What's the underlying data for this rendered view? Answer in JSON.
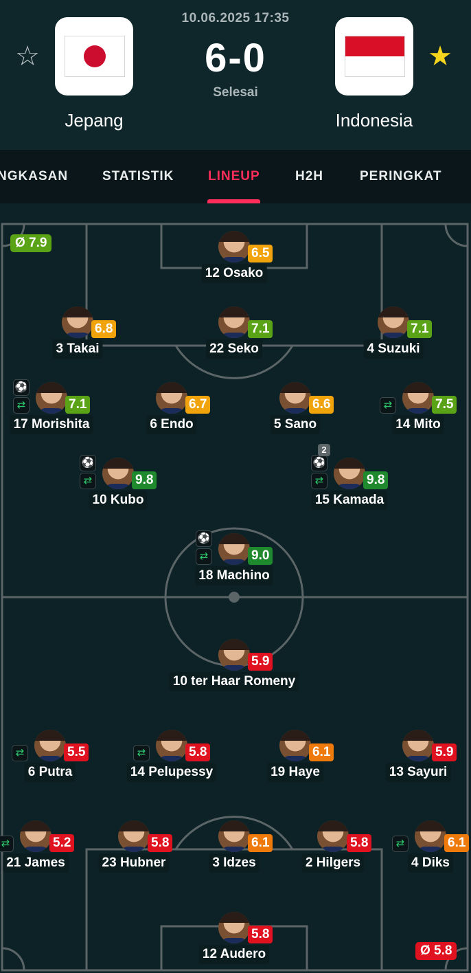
{
  "match": {
    "datetime": "10.06.2025 17:35",
    "score": "6-0",
    "status": "Selesai",
    "home": {
      "name": "Jepang",
      "favorite": false,
      "flag_icon": "japan-flag",
      "avg_rating": "Ø 7.9"
    },
    "away": {
      "name": "Indonesia",
      "favorite": true,
      "flag_icon": "indonesia-flag",
      "avg_rating": "Ø 5.8"
    }
  },
  "tabs": [
    {
      "label": "NGKASAN",
      "active": false
    },
    {
      "label": "STATISTIK",
      "active": false
    },
    {
      "label": "LINEUP",
      "active": true
    },
    {
      "label": "H2H",
      "active": false
    },
    {
      "label": "PERINGKAT",
      "active": false
    }
  ],
  "rating_colors": {
    "excellent": "#1f8a2d",
    "good": "#5aa317",
    "average": "#f0a30a",
    "fair": "#ee7a0c",
    "poor": "#e0121f"
  },
  "home_players": [
    {
      "label": "12 Osako",
      "rating": "6.5",
      "grade": "average"
    },
    {
      "label": "3 Takai",
      "rating": "6.8",
      "grade": "average"
    },
    {
      "label": "22 Seko",
      "rating": "7.1",
      "grade": "good"
    },
    {
      "label": "4 Suzuki",
      "rating": "7.1",
      "grade": "good"
    },
    {
      "label": "17 Morishita",
      "rating": "7.1",
      "grade": "good",
      "events": [
        "goal-icon",
        "substitution-icon"
      ]
    },
    {
      "label": "6 Endo",
      "rating": "6.7",
      "grade": "average"
    },
    {
      "label": "5 Sano",
      "rating": "6.6",
      "grade": "average"
    },
    {
      "label": "14 Mito",
      "rating": "7.5",
      "grade": "good",
      "events": [
        "substitution-icon"
      ]
    },
    {
      "label": "10 Kubo",
      "rating": "9.8",
      "grade": "excellent",
      "events": [
        "goal-icon",
        "substitution-icon"
      ]
    },
    {
      "label": "15 Kamada",
      "rating": "9.8",
      "grade": "excellent",
      "events": [
        "goal-icon",
        "substitution-icon"
      ],
      "goal_count": "2"
    },
    {
      "label": "18 Machino",
      "rating": "9.0",
      "grade": "excellent",
      "events": [
        "goal-icon",
        "substitution-icon"
      ]
    }
  ],
  "away_players": [
    {
      "label": "10 ter Haar Romeny",
      "rating": "5.9",
      "grade": "poor"
    },
    {
      "label": "6 Putra",
      "rating": "5.5",
      "grade": "poor",
      "events": [
        "substitution-icon"
      ]
    },
    {
      "label": "14 Pelupessy",
      "rating": "5.8",
      "grade": "poor",
      "events": [
        "substitution-icon"
      ]
    },
    {
      "label": "19 Haye",
      "rating": "6.1",
      "grade": "fair"
    },
    {
      "label": "13 Sayuri",
      "rating": "5.9",
      "grade": "poor"
    },
    {
      "label": "21 James",
      "rating": "5.2",
      "grade": "poor",
      "events": [
        "substitution-icon"
      ]
    },
    {
      "label": "23 Hubner",
      "rating": "5.8",
      "grade": "poor"
    },
    {
      "label": "3 Idzes",
      "rating": "6.1",
      "grade": "fair"
    },
    {
      "label": "2 Hilgers",
      "rating": "5.8",
      "grade": "poor"
    },
    {
      "label": "4 Diks",
      "rating": "6.1",
      "grade": "fair",
      "events": [
        "substitution-icon"
      ]
    },
    {
      "label": "12 Audero",
      "rating": "5.8",
      "grade": "poor"
    }
  ]
}
